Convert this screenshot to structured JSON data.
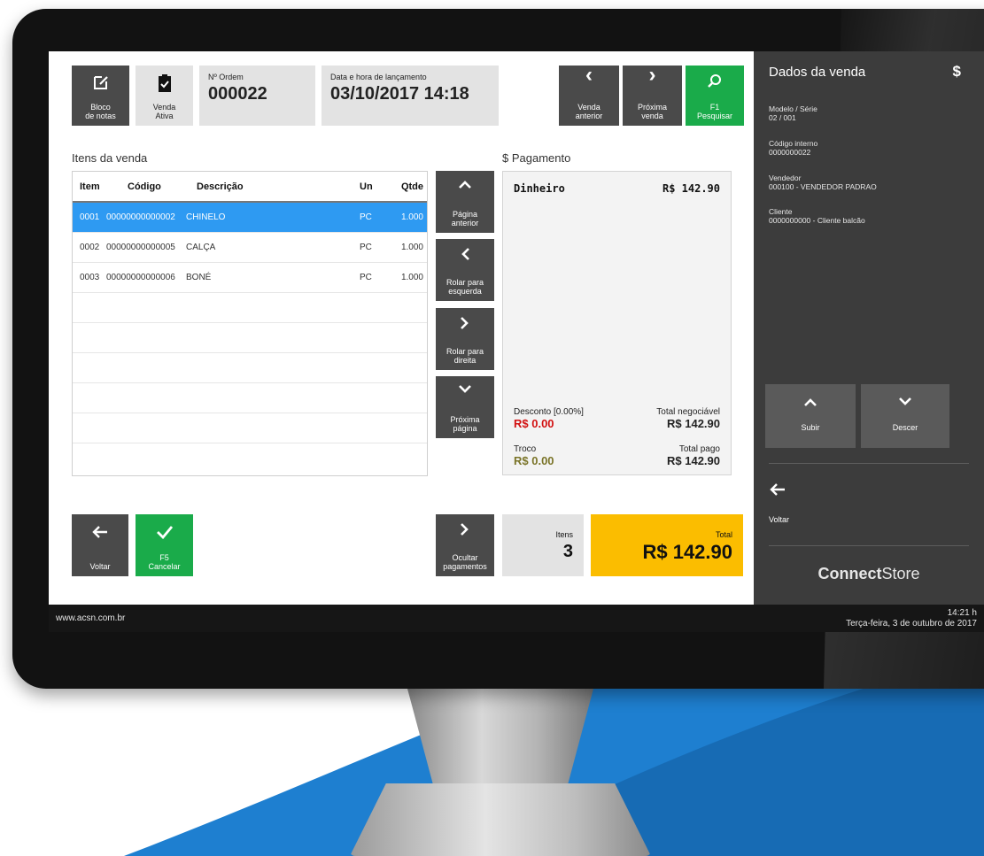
{
  "footer": {
    "url": "www.acsn.com.br",
    "time": "14:21 h",
    "date": "Terça-feira, 3 de outubro de 2017"
  },
  "toolbar": {
    "notepad_line1": "Bloco",
    "notepad_line2": "de notas",
    "active_sale_line1": "Venda",
    "active_sale_line2": "Ativa",
    "order_label": "Nº Ordem",
    "order_value": "000022",
    "datetime_label": "Data e hora de lançamento",
    "datetime_value": "03/10/2017 14:18",
    "prev_sale_line1": "Venda",
    "prev_sale_line2": "anterior",
    "next_sale_line1": "Próxima",
    "next_sale_line2": "venda",
    "search_line1": "F1",
    "search_line2": "Pesquisar"
  },
  "items": {
    "title": "Itens da venda",
    "columns": [
      "Item",
      "Código",
      "Descrição",
      "Un",
      "Qtde"
    ],
    "rows": [
      {
        "item": "0001",
        "codigo": "00000000000002",
        "descricao": "CHINELO",
        "un": "PC",
        "qtde": "1.000"
      },
      {
        "item": "0002",
        "codigo": "00000000000005",
        "descricao": "CALÇA",
        "un": "PC",
        "qtde": "1.000"
      },
      {
        "item": "0003",
        "codigo": "00000000000006",
        "descricao": "BONÉ",
        "un": "PC",
        "qtde": "1.000"
      }
    ]
  },
  "nav": {
    "page_prev_line1": "Página",
    "page_prev_line2": "anterior",
    "scroll_left_line1": "Rolar para",
    "scroll_left_line2": "esquerda",
    "scroll_right_line1": "Rolar para",
    "scroll_right_line2": "direita",
    "page_next_line1": "Próxima",
    "page_next_line2": "página"
  },
  "payment": {
    "title": "$ Pagamento",
    "method": "Dinheiro",
    "method_value": "R$ 142.90",
    "discount_label": "Desconto [0.00%]",
    "discount_value": "R$ 0.00",
    "negotiable_label": "Total negociável",
    "negotiable_value": "R$ 142.90",
    "change_label": "Troco",
    "change_value": "R$ 0.00",
    "paid_label": "Total pago",
    "paid_value": "R$ 142.90"
  },
  "bottom": {
    "back_label": "Voltar",
    "cancel_line1": "F5",
    "cancel_line2": "Cancelar",
    "hide_line1": "Ocultar",
    "hide_line2": "pagamentos",
    "itens_label": "Itens",
    "itens_value": "3",
    "total_label": "Total",
    "total_value": "R$ 142.90"
  },
  "side": {
    "title": "Dados da venda",
    "dollar": "$",
    "modelo_label": "Modelo / Série",
    "modelo_value": "02 / 001",
    "codigo_label": "Código interno",
    "codigo_value": "0000000022",
    "vendedor_label": "Vendedor",
    "vendedor_value": "000100 - VENDEDOR PADRAO",
    "cliente_label": "Cliente",
    "cliente_value": "0000000000 - Cliente balcão",
    "up_label": "Subir",
    "down_label": "Descer",
    "back_label": "Voltar",
    "brand_bold": "Connect",
    "brand_light": "Store"
  },
  "colors": {
    "green": "#1aab4a",
    "selected_row": "#2e9af2",
    "total_tile": "#fbbd00",
    "discount_red": "#d21010",
    "side_panel": "#3c3c3c",
    "backdrop_blue": "#1e7fd0"
  }
}
